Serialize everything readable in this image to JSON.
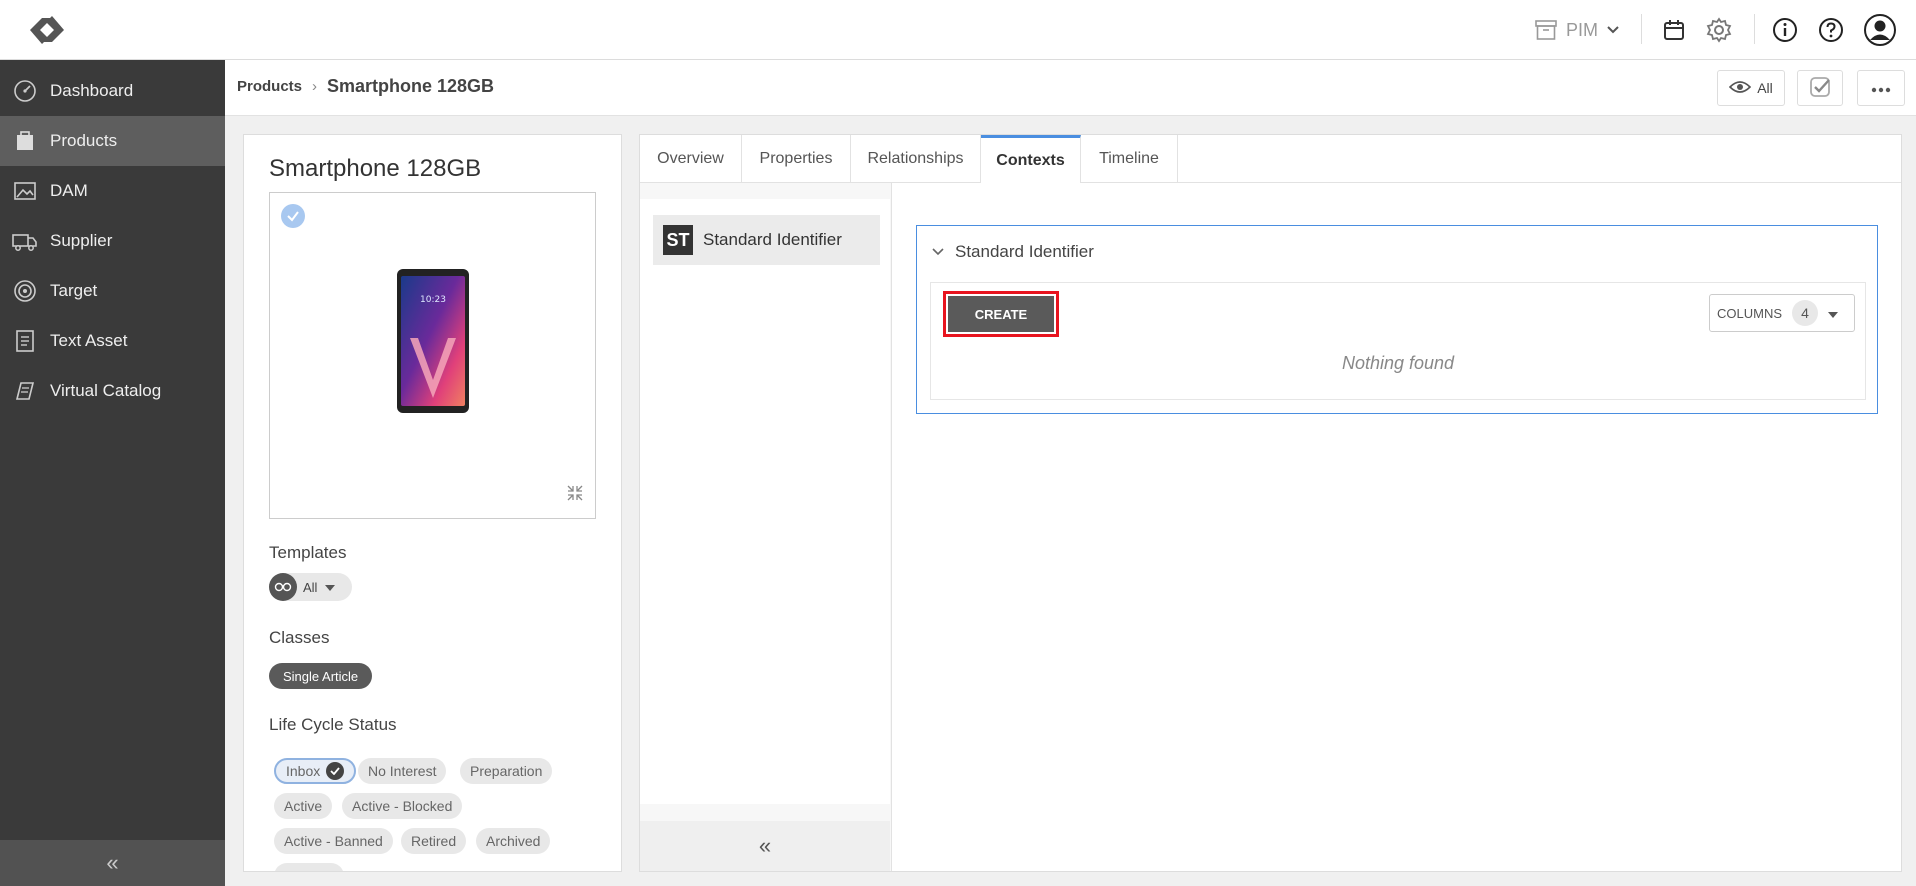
{
  "topbar": {
    "module_label": "PIM",
    "icons": [
      "logo-icon",
      "archive-icon",
      "chevron-down-icon",
      "catalog-icon",
      "gear-icon",
      "info-icon",
      "help-icon",
      "user-icon"
    ]
  },
  "sidebar": {
    "items": [
      {
        "label": "Dashboard",
        "icon": "dashboard-icon"
      },
      {
        "label": "Products",
        "icon": "products-icon",
        "active": true
      },
      {
        "label": "DAM",
        "icon": "image-icon"
      },
      {
        "label": "Supplier",
        "icon": "truck-icon"
      },
      {
        "label": "Target",
        "icon": "target-icon"
      },
      {
        "label": "Text Asset",
        "icon": "document-icon"
      },
      {
        "label": "Virtual Catalog",
        "icon": "book-icon"
      }
    ],
    "collapse_glyph": "«"
  },
  "header": {
    "breadcrumb_root": "Products",
    "breadcrumb_sep": "›",
    "breadcrumb_current": "Smartphone 128GB",
    "view_label": "All"
  },
  "product": {
    "title": "Smartphone 128GB",
    "templates_label": "Templates",
    "templates_value": "All",
    "classes_label": "Classes",
    "class_value": "Single Article",
    "lifecycle_label": "Life Cycle Status",
    "statuses": [
      "Inbox",
      "No Interest",
      "Preparation",
      "Active",
      "Active - Blocked",
      "Active - Banned",
      "Retired",
      "Archived"
    ]
  },
  "tabs": [
    "Overview",
    "Properties",
    "Relationships",
    "Contexts",
    "Timeline"
  ],
  "active_tab": "Contexts",
  "contexts": {
    "badge": "ST",
    "item_label": "Standard Identifier",
    "collapse_glyph": "«",
    "block_title": "Standard Identifier",
    "create_label": "CREATE",
    "columns_label": "COLUMNS",
    "columns_count": "4",
    "empty_text": "Nothing found"
  },
  "colors": {
    "sidebar_bg": "#3a3a3a",
    "active_tab": "#4a8ee0",
    "create_highlight": "#e8141f"
  }
}
